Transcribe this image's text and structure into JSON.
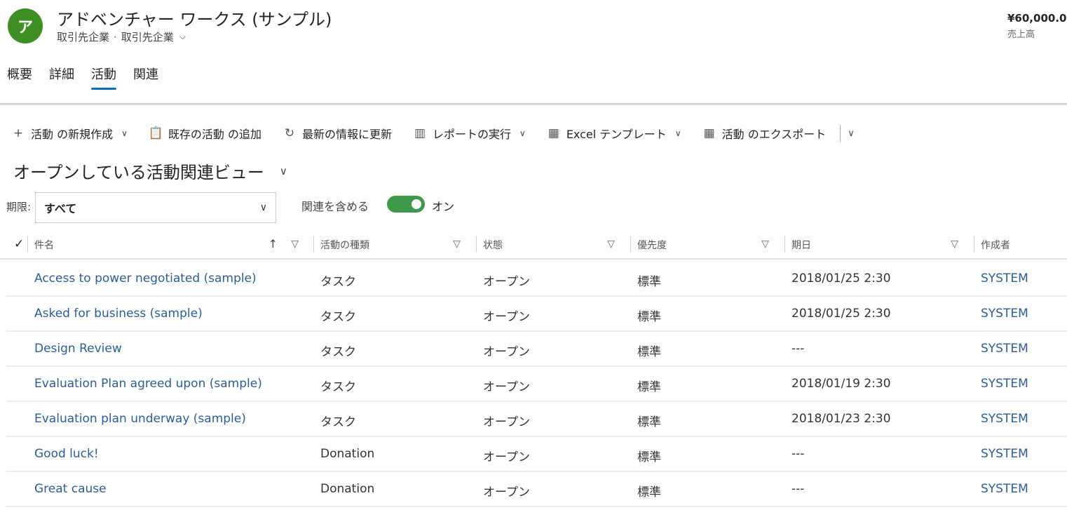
{
  "header": {
    "avatar_initial": "ア",
    "avatar_color": "#3d8e23",
    "title": "アドベンチャー ワークス (サンプル)",
    "entity_type": "取引先企業",
    "separator": "·",
    "form_name": "取引先企業",
    "kpi_value": "¥60,000.00",
    "kpi_label": "売上高"
  },
  "tabs": [
    {
      "label": "概要",
      "active": false
    },
    {
      "label": "詳細",
      "active": false
    },
    {
      "label": "活動",
      "active": true
    },
    {
      "label": "関連",
      "active": false
    }
  ],
  "toolbar": {
    "new_activity": "活動 の新規作成",
    "add_existing": "既存の活動 の追加",
    "refresh": "最新の情報に更新",
    "run_report": "レポートの実行",
    "excel_templates": "Excel テンプレート",
    "export": "活動 のエクスポート"
  },
  "view": {
    "title": "オープンしている活動関連ビュー"
  },
  "filters": {
    "period_label": "期限:",
    "period_value": "すべて",
    "include_related_label": "関連を含める",
    "include_related_state": "オン",
    "toggle_color": "#3e9a4a"
  },
  "columns": {
    "subject": "件名",
    "activity_type": "活動の種類",
    "status": "状態",
    "priority": "優先度",
    "due": "期日",
    "created_by": "作成者"
  },
  "rows": [
    {
      "subject": "Access to power negotiated (sample)",
      "activity_type": "タスク",
      "status": "オープン",
      "priority": "標準",
      "due": "2018/01/25 2:30",
      "created_by": "SYSTEM"
    },
    {
      "subject": "Asked for business (sample)",
      "activity_type": "タスク",
      "status": "オープン",
      "priority": "標準",
      "due": "2018/01/25 2:30",
      "created_by": "SYSTEM"
    },
    {
      "subject": "Design Review",
      "activity_type": "タスク",
      "status": "オープン",
      "priority": "標準",
      "due": "---",
      "created_by": "SYSTEM"
    },
    {
      "subject": "Evaluation Plan agreed upon (sample)",
      "activity_type": "タスク",
      "status": "オープン",
      "priority": "標準",
      "due": "2018/01/19 2:30",
      "created_by": "SYSTEM"
    },
    {
      "subject": "Evaluation plan underway (sample)",
      "activity_type": "タスク",
      "status": "オープン",
      "priority": "標準",
      "due": "2018/01/23 2:30",
      "created_by": "SYSTEM"
    },
    {
      "subject": "Good luck!",
      "activity_type": "Donation",
      "status": "オープン",
      "priority": "標準",
      "due": "---",
      "created_by": "SYSTEM"
    },
    {
      "subject": "Great cause",
      "activity_type": "Donation",
      "status": "オープン",
      "priority": "標準",
      "due": "---",
      "created_by": "SYSTEM"
    }
  ],
  "link_color": "#2b5d9c",
  "accent_color": "#0f6cbd"
}
